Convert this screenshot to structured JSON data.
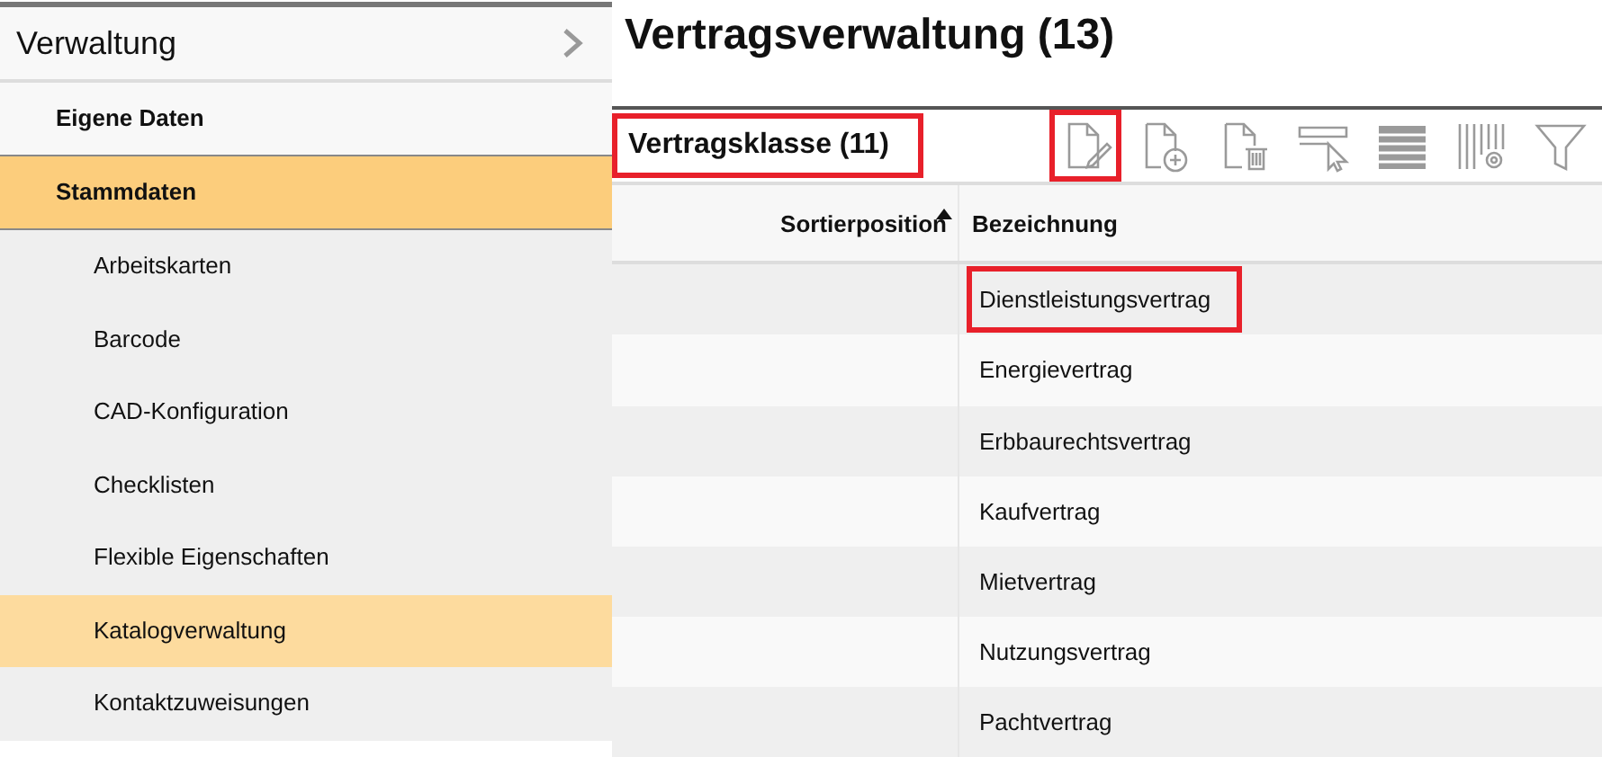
{
  "sidebar": {
    "title": "Verwaltung",
    "items": [
      {
        "label": "Eigene Daten",
        "selected": false
      },
      {
        "label": "Stammdaten",
        "selected": true,
        "children": [
          {
            "label": "Arbeitskarten",
            "selected": false
          },
          {
            "label": "Barcode",
            "selected": false
          },
          {
            "label": "CAD-Konfiguration",
            "selected": false
          },
          {
            "label": "Checklisten",
            "selected": false
          },
          {
            "label": "Flexible Eigenschaften",
            "selected": false
          },
          {
            "label": "Katalogverwaltung",
            "selected": true
          },
          {
            "label": "Kontaktzuweisungen",
            "selected": false
          }
        ]
      }
    ]
  },
  "page_title": "Vertragsverwaltung (13)",
  "panel": {
    "title": "Vertragsklasse (11)",
    "highlighted": true,
    "toolbar": [
      {
        "kind": "edit",
        "highlighted": true
      },
      {
        "kind": "add",
        "highlighted": false
      },
      {
        "kind": "delete",
        "highlighted": false
      },
      {
        "kind": "select",
        "highlighted": false
      },
      {
        "kind": "rows",
        "highlighted": false
      },
      {
        "kind": "columns",
        "highlighted": false
      },
      {
        "kind": "filter",
        "highlighted": false
      }
    ]
  },
  "table": {
    "columns": [
      {
        "label": "Sortierposition",
        "sorted": true
      },
      {
        "label": "Bezeichnung",
        "sorted": false
      }
    ],
    "rows": [
      {
        "name": "Dienstleistungsvertrag",
        "highlighted": true
      },
      {
        "name": "Energievertrag",
        "highlighted": false
      },
      {
        "name": "Erbbaurechtsvertrag",
        "highlighted": false
      },
      {
        "name": "Kaufvertrag",
        "highlighted": false
      },
      {
        "name": "Mietvertrag",
        "highlighted": false
      },
      {
        "name": "Nutzungsvertrag",
        "highlighted": false
      },
      {
        "name": "Pachtvertrag",
        "highlighted": false
      }
    ]
  }
}
